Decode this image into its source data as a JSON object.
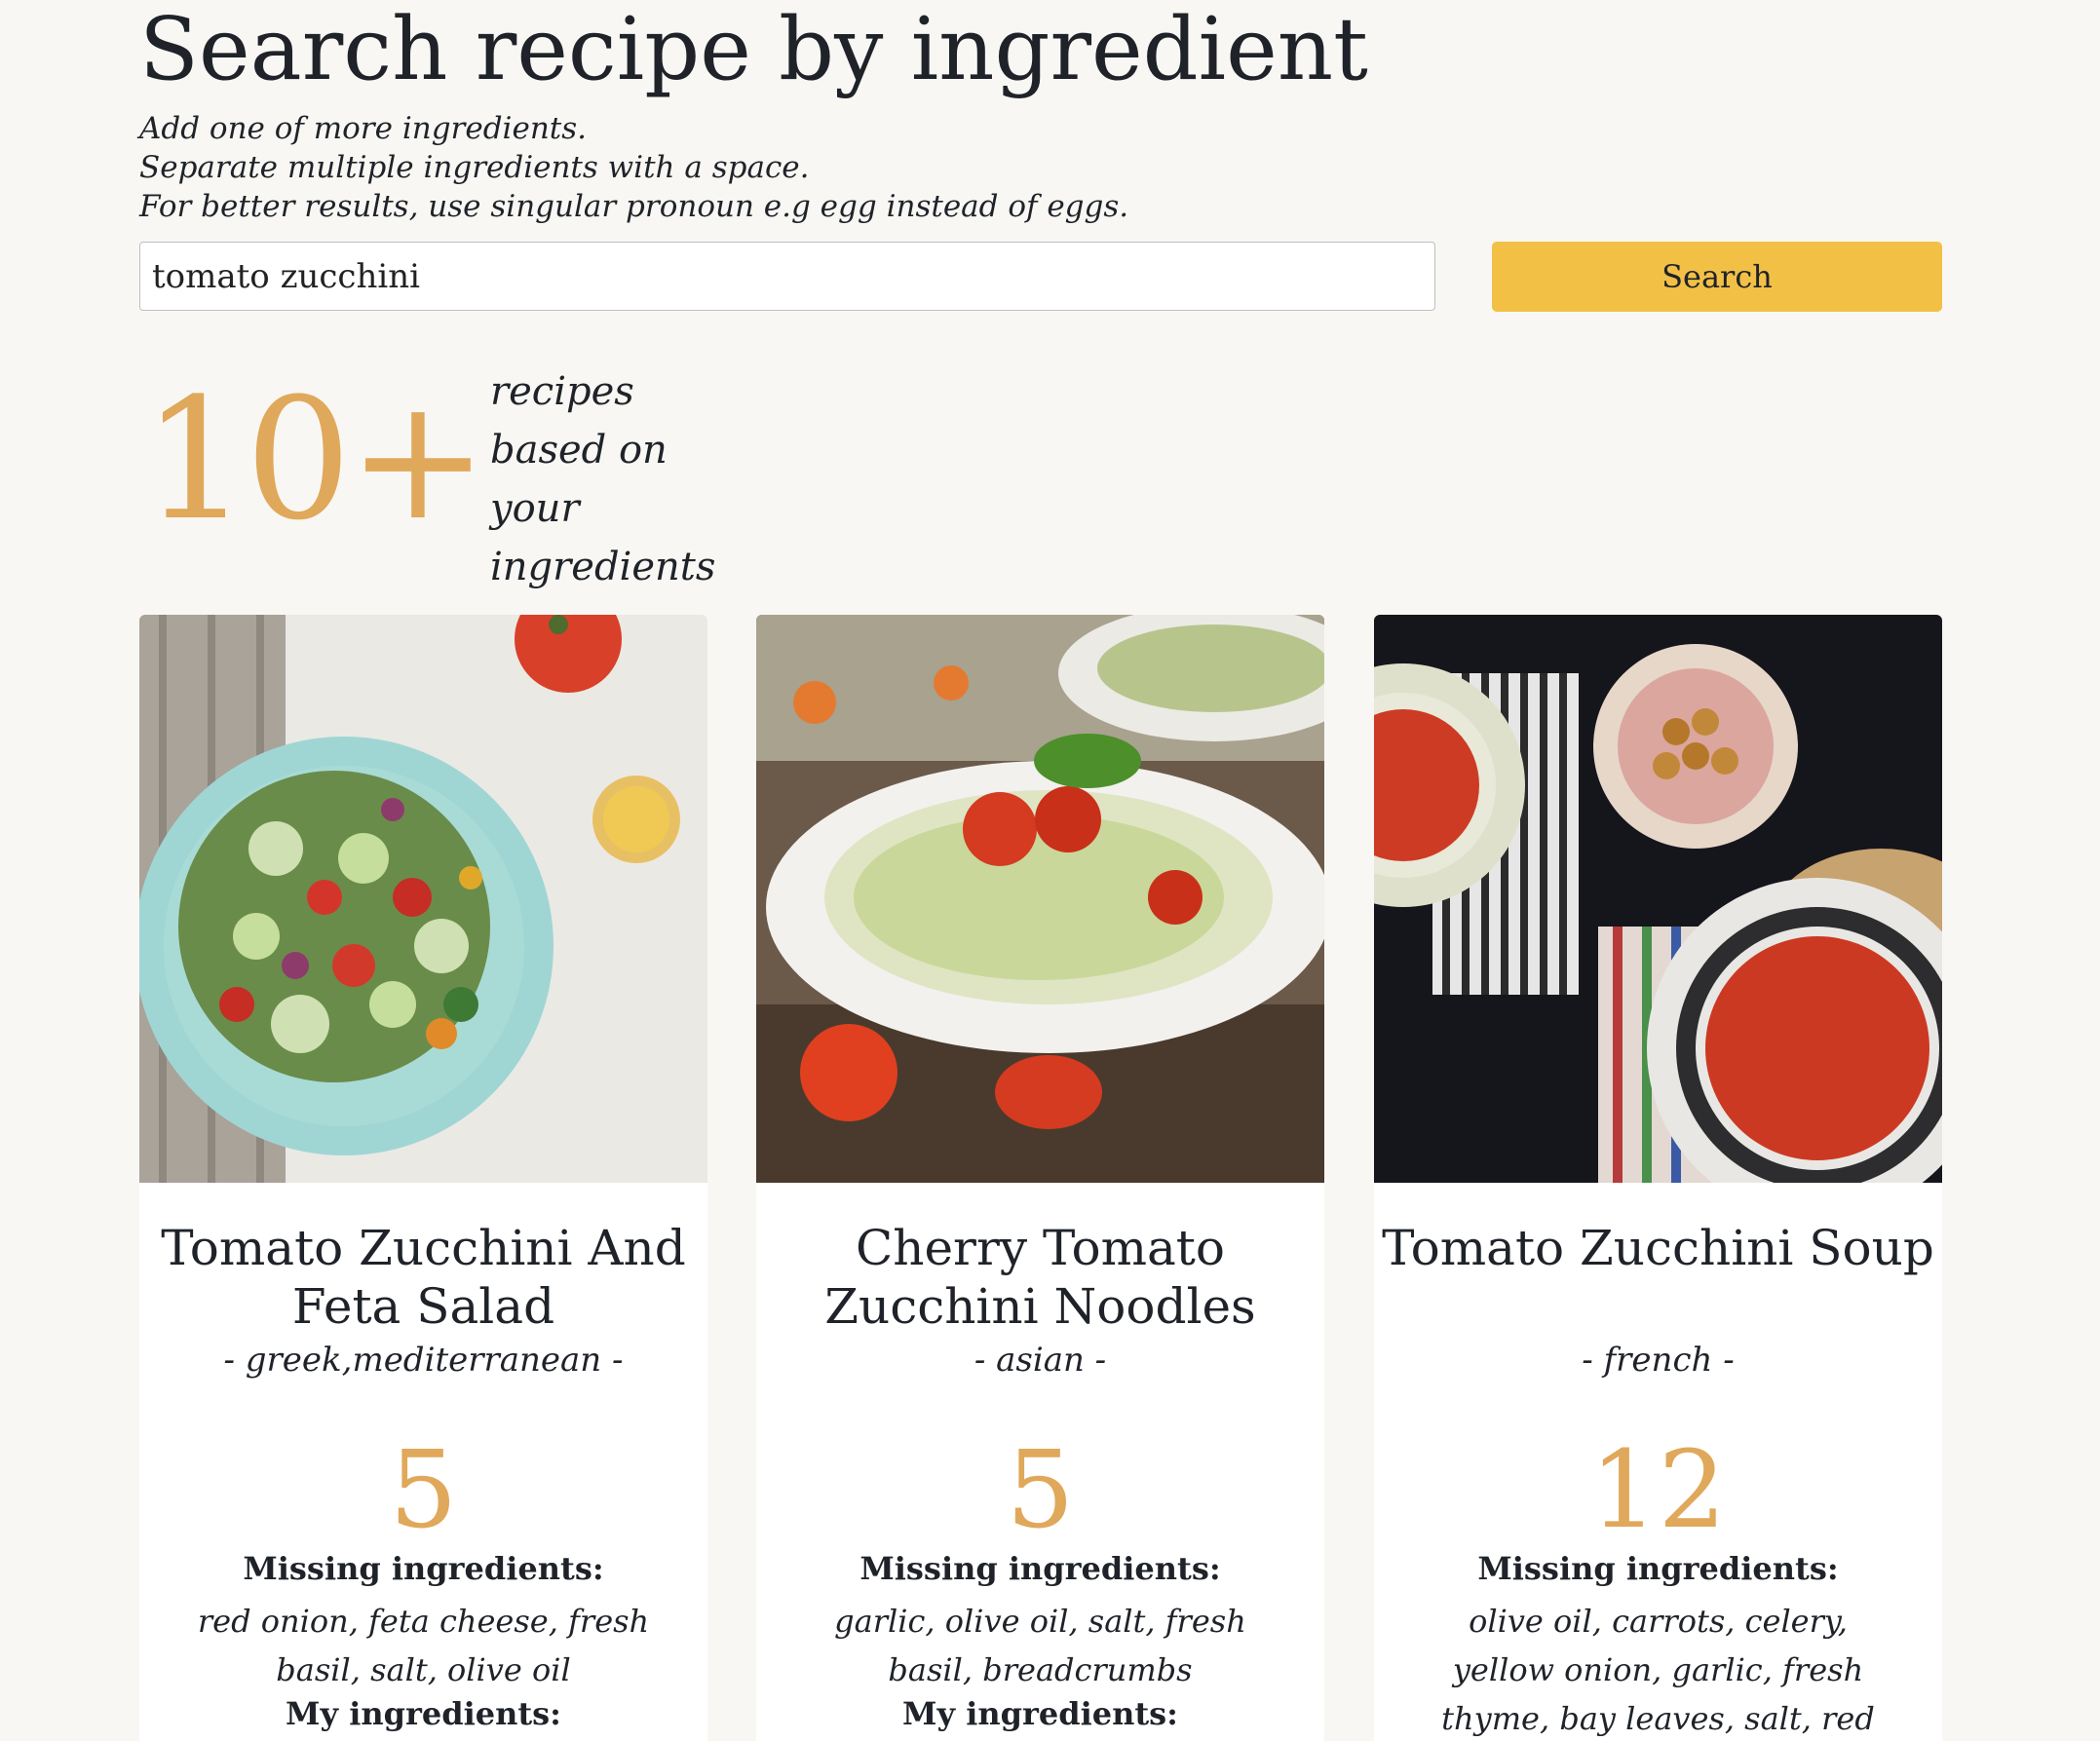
{
  "header": {
    "title": "Search recipe by ingredient",
    "hints": [
      "Add one of more ingredients.",
      "Separate multiple ingredients with a space.",
      "For better results, use singular pronoun e.g egg instead of eggs."
    ]
  },
  "search": {
    "value": "tomato zucchini",
    "button_label": "Search"
  },
  "results": {
    "count": "10+",
    "description": "recipes based on your ingredients"
  },
  "cards": [
    {
      "title": "Tomato Zucchini And Feta Salad",
      "cuisine": "- greek,mediterranean -",
      "missing_count": "5",
      "missing_label": "Missing ingredients:",
      "missing_list": "red onion, feta cheese, fresh basil, salt, olive oil",
      "my_label": "My ingredients:"
    },
    {
      "title": "Cherry Tomato Zucchini Noodles",
      "cuisine": "- asian -",
      "missing_count": "5",
      "missing_label": "Missing ingredients:",
      "missing_list": "garlic, olive oil, salt, fresh basil, breadcrumbs",
      "my_label": "My ingredients:"
    },
    {
      "title": "Tomato Zucchini Soup",
      "cuisine": "- french -",
      "missing_count": "12",
      "missing_label": "Missing ingredients:",
      "missing_list": "olive oil, carrots, celery, yellow onion, garlic, fresh thyme, bay leaves, salt, red pepper flakes,",
      "my_label": ""
    }
  ],
  "colors": {
    "background": "#f8f7f3",
    "accent": "#e0a85a",
    "button": "#f3c046",
    "text": "#1f2329"
  }
}
